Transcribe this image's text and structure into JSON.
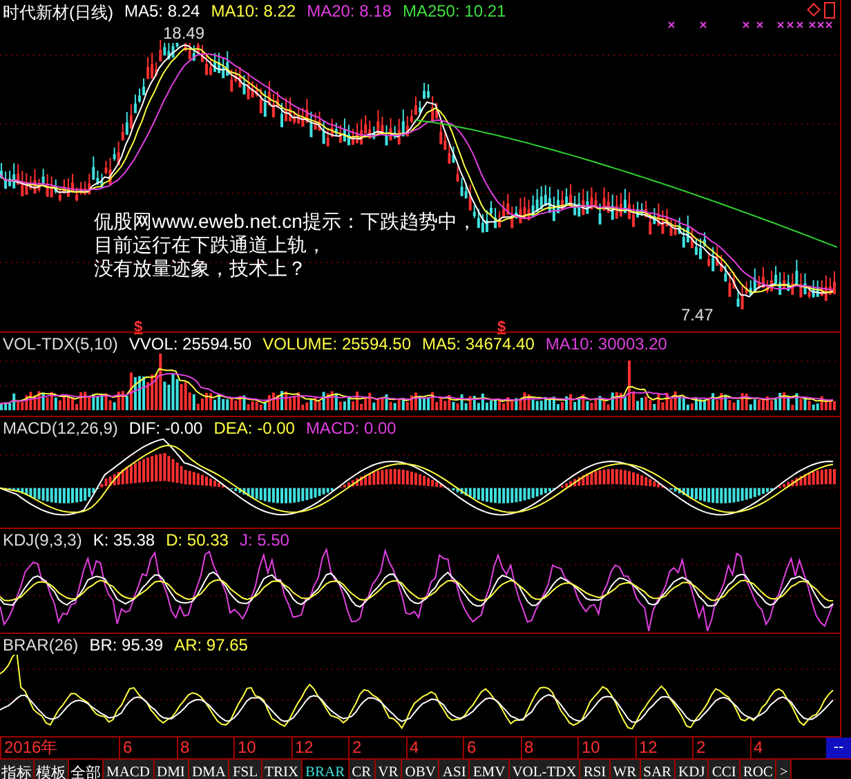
{
  "main_chart": {
    "title": "时代新材(日线)",
    "values": [
      {
        "label": "MA5: 8.24",
        "color": "#ffffff"
      },
      {
        "label": "MA10: 8.22",
        "color": "#ffff40"
      },
      {
        "label": "MA20: 8.18",
        "color": "#e040e0"
      },
      {
        "label": "MA250: 10.21",
        "color": "#40e040"
      }
    ],
    "high_label": "18.49",
    "low_label": "7.47",
    "annotation": [
      "侃股网www.eweb.net.cn提示：下跌趋势中，",
      "目前运行在下跌通道上轨，",
      "没有放量迹象，技术上？"
    ],
    "markers": [
      {
        "symbol": "$"
      },
      {
        "symbol": "$"
      }
    ]
  },
  "indicators": [
    {
      "kind": "vol",
      "title": "VOL-TDX(5,10)",
      "values": [
        {
          "label": "VVOL: 25594.50",
          "color": "#ffffff"
        },
        {
          "label": "VOLUME: 25594.50",
          "color": "#ffff40"
        },
        {
          "label": "MA5: 34674.40",
          "color": "#ffff40"
        },
        {
          "label": "MA10: 30003.20",
          "color": "#e040e0"
        }
      ]
    },
    {
      "kind": "macd",
      "title": "MACD(12,26,9)",
      "values": [
        {
          "label": "DIF: -0.00",
          "color": "#ffffff"
        },
        {
          "label": "DEA: -0.00",
          "color": "#ffff40"
        },
        {
          "label": "MACD: 0.00",
          "color": "#e040e0"
        }
      ]
    },
    {
      "kind": "kdj",
      "title": "KDJ(9,3,3)",
      "values": [
        {
          "label": "K: 35.38",
          "color": "#ffffff"
        },
        {
          "label": "D: 50.33",
          "color": "#ffff40"
        },
        {
          "label": "J: 5.50",
          "color": "#e040e0"
        }
      ]
    },
    {
      "kind": "brar",
      "title": "BRAR(26)",
      "values": [
        {
          "label": "BR: 95.39",
          "color": "#ffffff"
        },
        {
          "label": "AR: 97.65",
          "color": "#ffff40"
        }
      ]
    }
  ],
  "time_axis": {
    "labels": [
      "2016年",
      "6",
      "8",
      "10",
      "12",
      "2",
      "4",
      "6",
      "8",
      "10",
      "12",
      "2",
      "4"
    ],
    "corner": "--"
  },
  "tabs": [
    {
      "label": "指标",
      "selected": false
    },
    {
      "label": "模板",
      "selected": false
    },
    {
      "label": "全部",
      "selected": true
    },
    {
      "label": "MACD",
      "selected": false
    },
    {
      "label": "DMI",
      "selected": false
    },
    {
      "label": "DMA",
      "selected": false
    },
    {
      "label": "FSL",
      "selected": false
    },
    {
      "label": "TRIX",
      "selected": false
    },
    {
      "label": "BRAR",
      "selected": true
    },
    {
      "label": "CR",
      "selected": false
    },
    {
      "label": "VR",
      "selected": false
    },
    {
      "label": "OBV",
      "selected": false
    },
    {
      "label": "ASI",
      "selected": false
    },
    {
      "label": "EMV",
      "selected": false
    },
    {
      "label": "VOL-TDX",
      "selected": false
    },
    {
      "label": "RSI",
      "selected": false
    },
    {
      "label": "WR",
      "selected": false
    },
    {
      "label": "SAR",
      "selected": false
    },
    {
      "label": "KDJ",
      "selected": false
    },
    {
      "label": "CCI",
      "selected": false
    },
    {
      "label": "ROC",
      "selected": false
    }
  ],
  "tab_scroll": ">"
}
